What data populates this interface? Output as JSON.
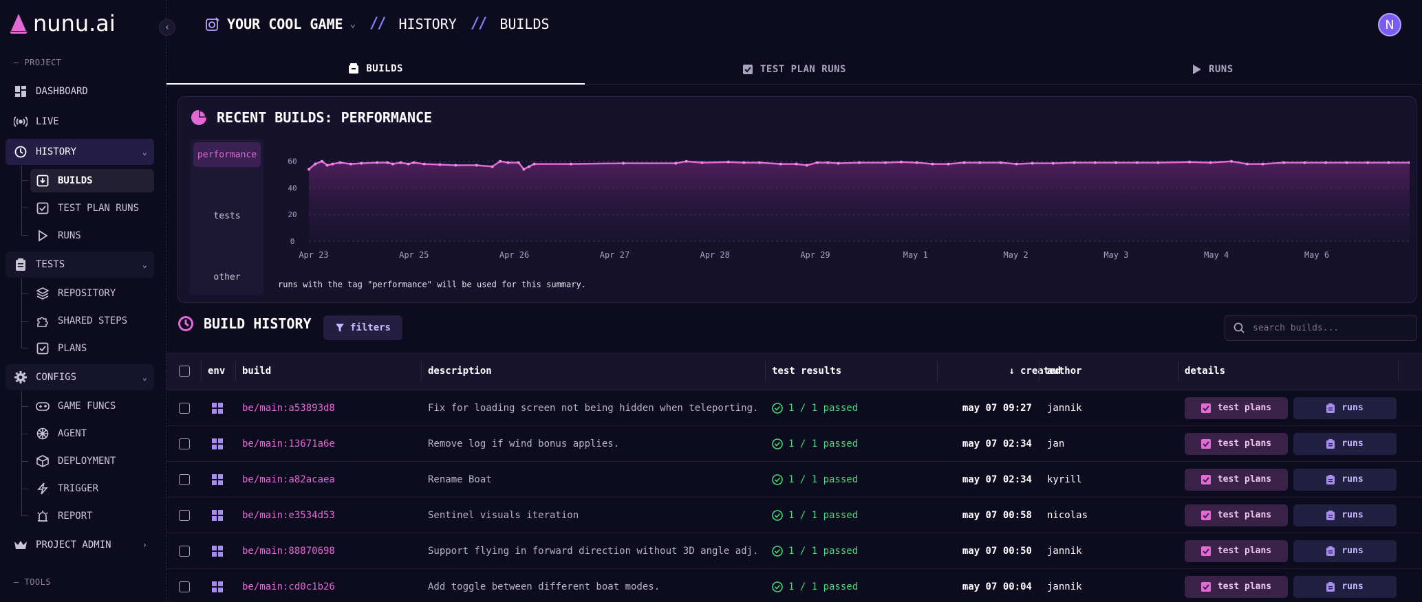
{
  "app": {
    "name": "nunu.ai"
  },
  "sidebar": {
    "project_label": "— PROJECT",
    "tools_label": "— TOOLS",
    "dashboard": "DASHBOARD",
    "live": "LIVE",
    "history": "HISTORY",
    "history_items": [
      "BUILDS",
      "TEST PLAN RUNS",
      "RUNS"
    ],
    "tests": "TESTS",
    "tests_items": [
      "REPOSITORY",
      "SHARED STEPS",
      "PLANS"
    ],
    "configs": "CONFIGS",
    "configs_items": [
      "GAME FUNCS",
      "AGENT",
      "DEPLOYMENT",
      "TRIGGER",
      "REPORT"
    ],
    "project_admin": "PROJECT ADMIN"
  },
  "header": {
    "project": "YOUR COOL GAME",
    "crumb1": "HISTORY",
    "crumb2": "BUILDS",
    "avatar": "N"
  },
  "tabs": {
    "builds": "BUILDS",
    "test_plan_runs": "TEST PLAN RUNS",
    "runs": "RUNS"
  },
  "summary": {
    "title": "RECENT BUILDS: PERFORMANCE",
    "tags": [
      "performance",
      "tests",
      "other"
    ],
    "note": "runs with the tag \"performance\" will be used for this summary."
  },
  "chart_data": {
    "type": "line",
    "x_ticks": [
      "Apr 23",
      "Apr 25",
      "Apr 26",
      "Apr 27",
      "Apr 28",
      "Apr 29",
      "May 1",
      "May 2",
      "May 3",
      "May 4",
      "May 6"
    ],
    "y_ticks": [
      0,
      20,
      40,
      60
    ],
    "ylim": [
      0,
      65
    ],
    "xlim": [
      0,
      11
    ],
    "points": [
      [
        0.0,
        54
      ],
      [
        0.12,
        58
      ],
      [
        0.25,
        60
      ],
      [
        0.35,
        57
      ],
      [
        0.45,
        58
      ],
      [
        0.6,
        59
      ],
      [
        0.8,
        58
      ],
      [
        1.0,
        58.5
      ],
      [
        1.3,
        59
      ],
      [
        1.5,
        59
      ],
      [
        1.6,
        58
      ],
      [
        1.75,
        59
      ],
      [
        1.9,
        58
      ],
      [
        2.0,
        59
      ],
      [
        2.2,
        58
      ],
      [
        2.5,
        57.5
      ],
      [
        2.8,
        57
      ],
      [
        3.2,
        57
      ],
      [
        3.5,
        56
      ],
      [
        3.65,
        60
      ],
      [
        3.8,
        59
      ],
      [
        4.0,
        59
      ],
      [
        4.1,
        54
      ],
      [
        4.2,
        56
      ],
      [
        4.3,
        58
      ],
      [
        5.0,
        58
      ],
      [
        6.0,
        58.5
      ],
      [
        7.0,
        58.5
      ],
      [
        7.2,
        60
      ],
      [
        7.5,
        59
      ],
      [
        8.0,
        59.5
      ],
      [
        8.3,
        59
      ],
      [
        8.6,
        59
      ],
      [
        9.0,
        58
      ],
      [
        9.3,
        58
      ],
      [
        9.5,
        57
      ],
      [
        9.7,
        59
      ],
      [
        9.9,
        59
      ],
      [
        10.1,
        58.5
      ],
      [
        10.5,
        59
      ],
      [
        11.0,
        59
      ],
      [
        11.3,
        59.5
      ],
      [
        11.6,
        59
      ],
      [
        11.9,
        58
      ],
      [
        12.2,
        58
      ],
      [
        12.5,
        59
      ],
      [
        12.8,
        59
      ],
      [
        13.2,
        59
      ],
      [
        13.5,
        58
      ],
      [
        13.8,
        58.5
      ],
      [
        14.2,
        58.5
      ],
      [
        14.6,
        59
      ],
      [
        15.0,
        59
      ],
      [
        15.4,
        59
      ],
      [
        15.8,
        59
      ],
      [
        16.2,
        59
      ],
      [
        16.8,
        59.5
      ],
      [
        17.2,
        59
      ],
      [
        17.6,
        60
      ],
      [
        17.9,
        58
      ],
      [
        18.2,
        58
      ],
      [
        18.6,
        59
      ],
      [
        19.0,
        59
      ],
      [
        19.4,
        59
      ],
      [
        19.8,
        59
      ],
      [
        20.2,
        59
      ],
      [
        20.6,
        59
      ],
      [
        21.0,
        59
      ]
    ]
  },
  "history": {
    "title": "BUILD HISTORY",
    "filters": "filters",
    "search_placeholder": "search builds...",
    "columns": {
      "env": "env",
      "build": "build",
      "description": "description",
      "test_results": "test results",
      "created": "created",
      "author": "author",
      "details": "details"
    },
    "test_plans_label": "test plans",
    "runs_label": "runs",
    "rows": [
      {
        "build": "be/main:a53893d8",
        "description": "Fix for loading screen not being hidden when teleporting...",
        "result": "1 / 1 passed",
        "created": "may 07 09:27",
        "author": "jannik"
      },
      {
        "build": "be/main:13671a6e",
        "description": "Remove log if wind bonus applies.",
        "result": "1 / 1 passed",
        "created": "may 07 02:34",
        "author": "jan"
      },
      {
        "build": "be/main:a82acaea",
        "description": "Rename Boat",
        "result": "1 / 1 passed",
        "created": "may 07 02:34",
        "author": "kyrill"
      },
      {
        "build": "be/main:e3534d53",
        "description": "Sentinel visuals iteration",
        "result": "1 / 1 passed",
        "created": "may 07 00:58",
        "author": "nicolas"
      },
      {
        "build": "be/main:88870698",
        "description": "Support flying in forward direction without 3D angle adj...",
        "result": "1 / 1 passed",
        "created": "may 07 00:50",
        "author": "jannik"
      },
      {
        "build": "be/main:cd0c1b26",
        "description": "Add toggle between different boat modes.",
        "result": "1 / 1 passed",
        "created": "may 07 00:04",
        "author": "jannik"
      }
    ]
  },
  "colors": {
    "accent": "#e36ad6",
    "purple": "#8a7cff",
    "pass": "#4cd97b"
  }
}
